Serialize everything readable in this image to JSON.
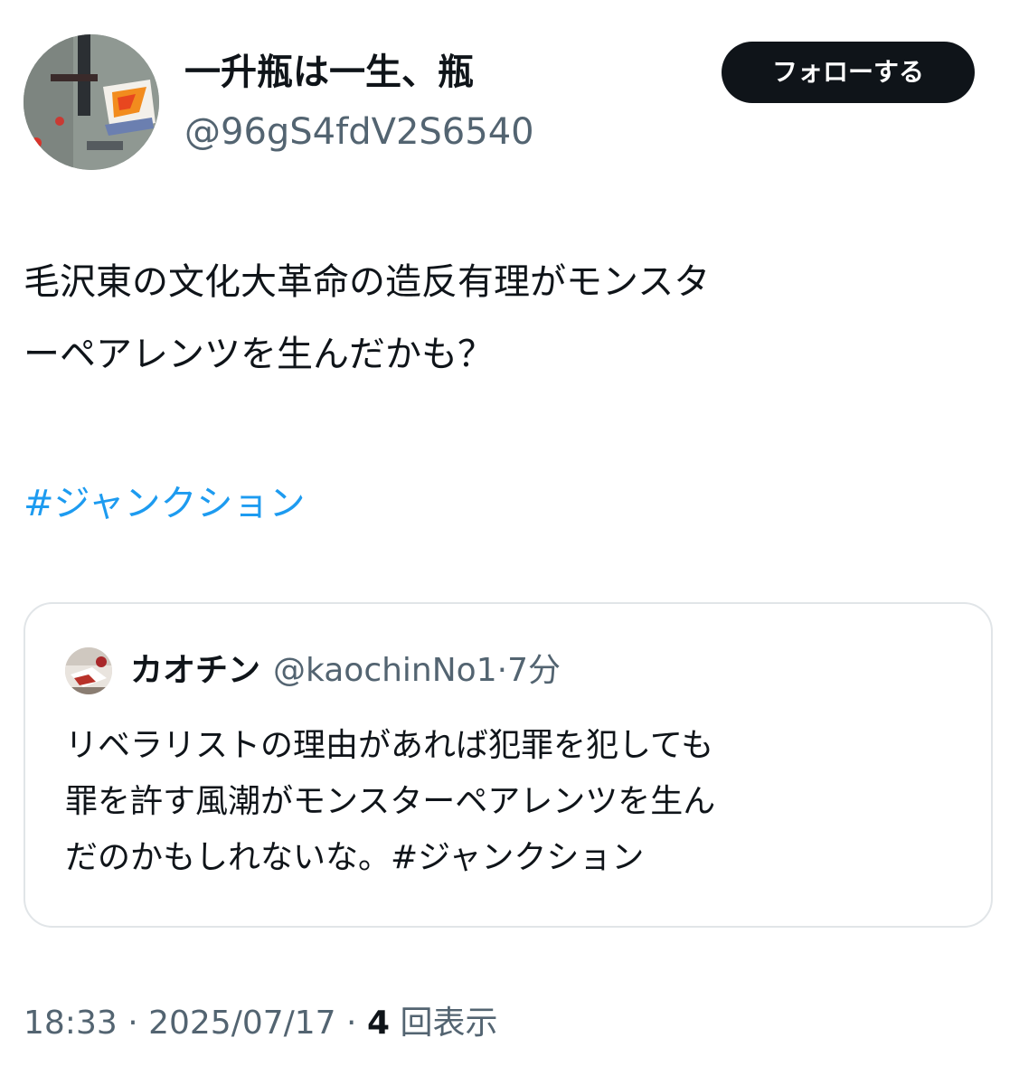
{
  "author": {
    "display_name": "一升瓶は一生、瓶",
    "handle": "@96gS4fdV2S6540",
    "avatar_icon": "abstract-painting-avatar"
  },
  "follow_button": {
    "label": "フォローする"
  },
  "tweet": {
    "text": "毛沢東の文化大革命の造反有理がモンスタ\nーペアレンツを生んだかも？",
    "hashtag": "#ジャンクション"
  },
  "quoted_tweet": {
    "display_name": "カオチン",
    "handle": "@kaochinNo1",
    "separator": "·",
    "time": "7分",
    "text_line1": "リベラリストの理由があれば犯罪を犯しても",
    "text_line2": "罪を許す風潮がモンスターペアレンツを生ん",
    "text_line3_prefix": "だのかもしれないな。",
    "hashtag": "#ジャンクション",
    "avatar_icon": "photo-avatar"
  },
  "meta": {
    "time": "18:33",
    "sep1": " · ",
    "date": "2025/07/17",
    "sep2": " · ",
    "views": "4",
    "views_label": " 回表示"
  },
  "colors": {
    "link": "#1d9bf0",
    "secondary": "#536471",
    "button_bg": "#0f1419",
    "border": "#e1e5e8"
  }
}
